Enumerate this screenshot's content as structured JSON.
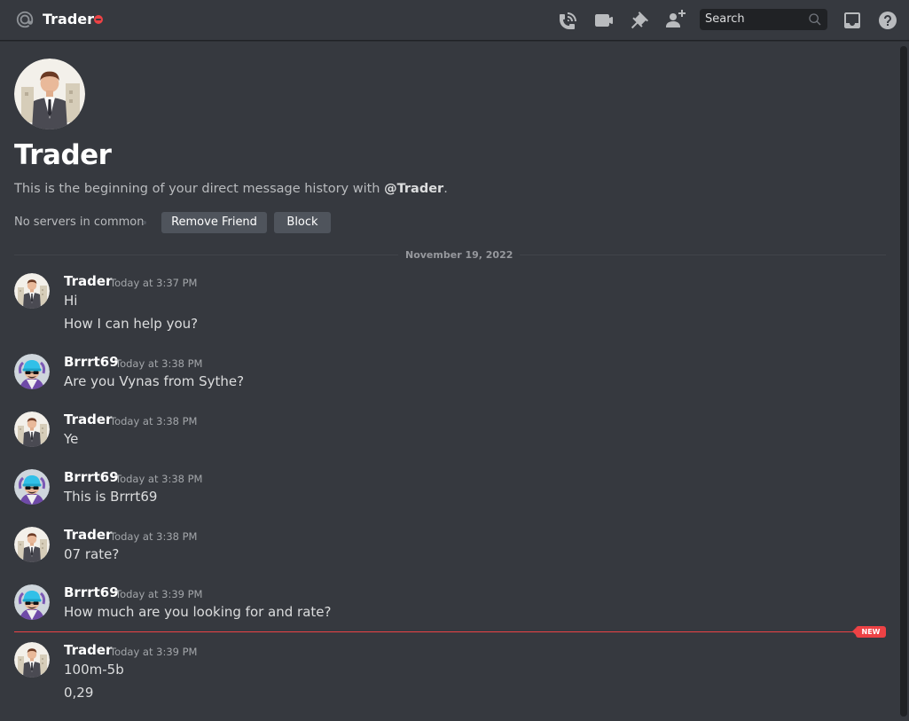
{
  "header": {
    "title": "Trader",
    "status_color": "#ed4245",
    "icons": [
      "at-icon",
      "voice-call-icon",
      "video-call-icon",
      "pinned-messages-icon",
      "add-friend-icon",
      "inbox-icon",
      "help-icon"
    ],
    "search_placeholder": "Search"
  },
  "intro": {
    "name": "Trader",
    "history_prefix": "This is the beginning of your direct message history with ",
    "history_handle": "@Trader",
    "history_suffix": ".",
    "servers_text": "No servers in common",
    "remove_friend_label": "Remove Friend",
    "block_label": "Block"
  },
  "date_divider": "November 19, 2022",
  "messages": [
    {
      "author": "Trader",
      "time": "Today at 3:37 PM",
      "lines": [
        "Hi",
        "How I can help you?"
      ]
    },
    {
      "author": "Brrrt69",
      "time": "Today at 3:38 PM",
      "lines": [
        "Are you Vynas from Sythe?"
      ]
    },
    {
      "author": "Trader",
      "time": "Today at 3:38 PM",
      "lines": [
        "Ye"
      ]
    },
    {
      "author": "Brrrt69",
      "time": "Today at 3:38 PM",
      "lines": [
        "This is Brrrt69"
      ]
    },
    {
      "author": "Trader",
      "time": "Today at 3:38 PM",
      "lines": [
        "07 rate?"
      ]
    },
    {
      "author": "Brrrt69",
      "time": "Today at 3:39 PM",
      "lines": [
        "How much are you looking for and rate?"
      ]
    },
    {
      "author": "Trader",
      "time": "Today at 3:39 PM",
      "lines": [
        "100m-5b",
        "0,29"
      ]
    }
  ],
  "new_badge": "NEW",
  "colors": {
    "background": "#36393f",
    "accent_red": "#ed4245",
    "button_gray": "#4f545c"
  }
}
